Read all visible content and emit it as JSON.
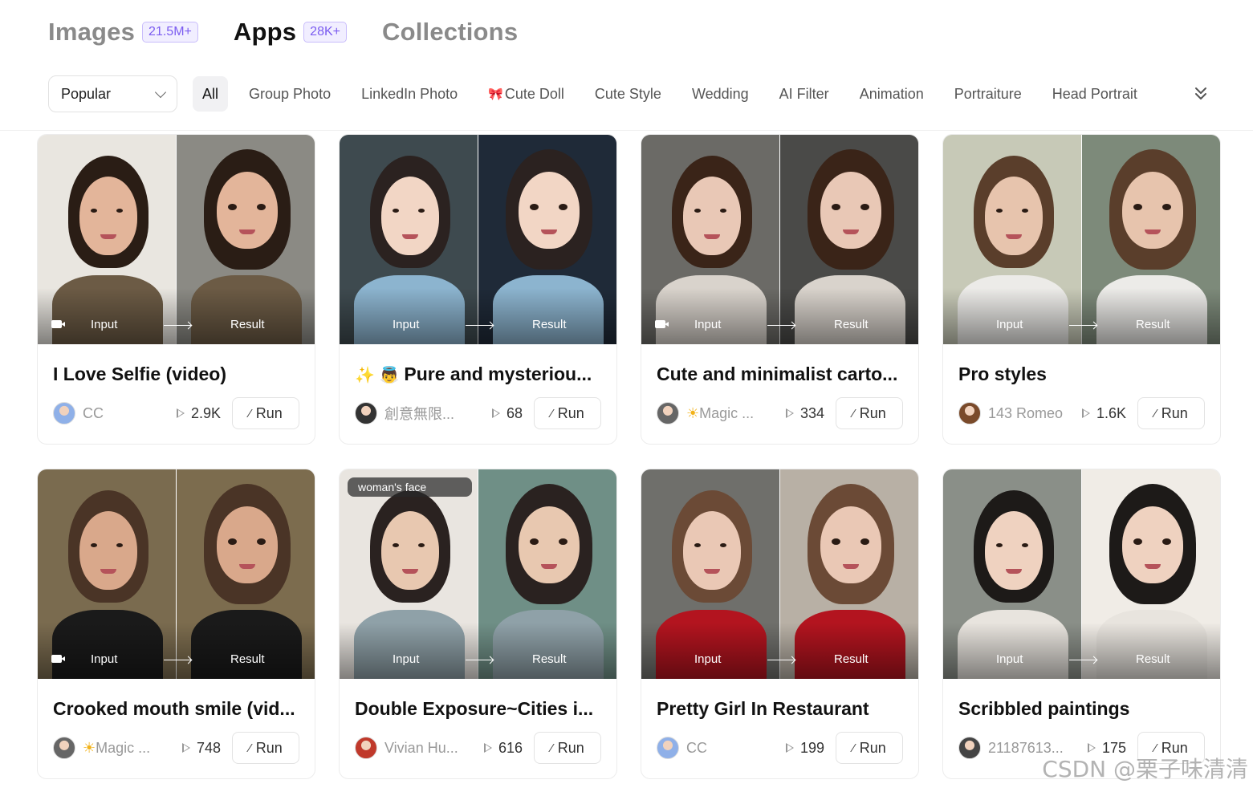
{
  "top_tabs": [
    {
      "label": "Images",
      "count": "21.5M+"
    },
    {
      "label": "Apps",
      "count": "28K+"
    },
    {
      "label": "Collections",
      "count": ""
    }
  ],
  "filters": {
    "sort_value": "Popular",
    "categories": [
      "All",
      "Group Photo",
      "LinkedIn Photo",
      "Cute Doll",
      "Cute Style",
      "Wedding",
      "AI Filter",
      "Animation",
      "Portraiture",
      "Head Portrait"
    ]
  },
  "thumb_labels": {
    "input": "Input",
    "result": "Result"
  },
  "run_label": "Run",
  "cards": [
    {
      "title": "I Love Selfie (video)",
      "title_emoji": "",
      "author": "CC",
      "author_prefix": "",
      "plays": "2.9K",
      "prompt_tag": "",
      "video": true,
      "colors": {
        "bg1": "#e9e6e0",
        "bg2": "#8b8a84",
        "skin": "#e3b59a",
        "hair": "#2a1d15",
        "cloth": "#6c5b45",
        "avatar": "#8fb0e8"
      }
    },
    {
      "title": "Pure and mysteriou...",
      "title_emoji": "✨ 👼",
      "author": "創意無限...",
      "author_prefix": "",
      "plays": "68",
      "prompt_tag": "",
      "video": false,
      "colors": {
        "bg1": "#3e4a4f",
        "bg2": "#1f2a38",
        "skin": "#f2d6c5",
        "hair": "#2b2220",
        "cloth": "#8cb4cf",
        "avatar": "#333333"
      }
    },
    {
      "title": "Cute and minimalist carto...",
      "title_emoji": "",
      "author": "Magic ...",
      "author_prefix": "☀",
      "plays": "334",
      "prompt_tag": "",
      "video": true,
      "colors": {
        "bg1": "#6b6a66",
        "bg2": "#4a4a48",
        "skin": "#e9c8b6",
        "hair": "#3a2418",
        "cloth": "#d9d3cc",
        "avatar": "#666666"
      }
    },
    {
      "title": "Pro styles",
      "title_emoji": "",
      "author": "143 Romeo",
      "author_prefix": "",
      "plays": "1.6K",
      "prompt_tag": "",
      "video": false,
      "colors": {
        "bg1": "#c7c9b7",
        "bg2": "#7d8a7a",
        "skin": "#e7c4ad",
        "hair": "#5a3e2b",
        "cloth": "#ecebe8",
        "avatar": "#7a4a2a"
      }
    },
    {
      "title": "Crooked mouth smile (vid...",
      "title_emoji": "",
      "author": "Magic ...",
      "author_prefix": "☀",
      "plays": "748",
      "prompt_tag": "",
      "video": true,
      "colors": {
        "bg1": "#7a6b4f",
        "bg2": "#7c6c4e",
        "skin": "#d9a88b",
        "hair": "#4a3426",
        "cloth": "#1a1a1a",
        "avatar": "#666666"
      }
    },
    {
      "title": "Double Exposure~Cities i...",
      "title_emoji": "",
      "author": "Vivian Hu...",
      "author_prefix": "",
      "plays": "616",
      "prompt_tag": "woman's face",
      "video": false,
      "colors": {
        "bg1": "#e9e5e0",
        "bg2": "#6f8f86",
        "skin": "#e8c8b0",
        "hair": "#2a2220",
        "cloth": "#8fa1a8",
        "avatar": "#c0392b"
      }
    },
    {
      "title": "Pretty Girl In Restaurant",
      "title_emoji": "",
      "author": "CC",
      "author_prefix": "",
      "plays": "199",
      "prompt_tag": "",
      "video": false,
      "colors": {
        "bg1": "#6f6f6b",
        "bg2": "#b8b0a5",
        "skin": "#eac8b5",
        "hair": "#6b4a36",
        "cloth": "#b3141f",
        "avatar": "#8fb0e8"
      }
    },
    {
      "title": "Scribbled paintings",
      "title_emoji": "",
      "author": "21187613...",
      "author_prefix": "",
      "plays": "175",
      "prompt_tag": "",
      "video": false,
      "colors": {
        "bg1": "#8a8f88",
        "bg2": "#f0ece6",
        "skin": "#efd2c0",
        "hair": "#1d1a18",
        "cloth": "#e8e4de",
        "avatar": "#444444"
      }
    }
  ],
  "watermark": "CSDN @栗子味清清"
}
